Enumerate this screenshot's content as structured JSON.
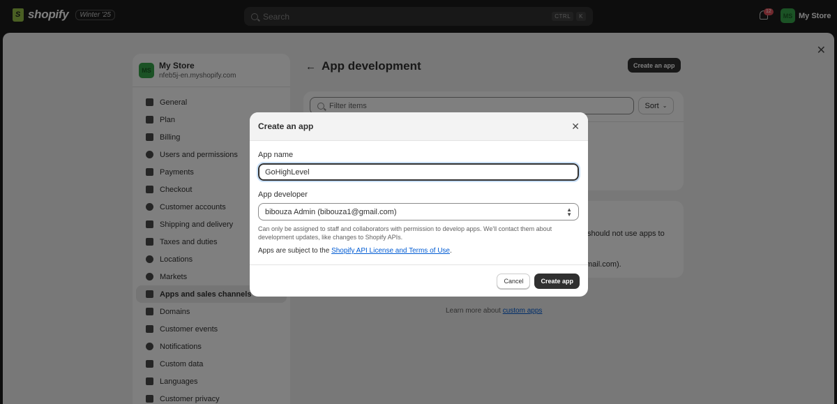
{
  "topbar": {
    "brand": "shopify",
    "edition_badge": "Winter '25",
    "search_placeholder": "Search",
    "shortcut_keys": [
      "CTRL",
      "K"
    ],
    "notification_count": "12",
    "user_initials": "MS",
    "user_name": "My Store"
  },
  "sidebar": {
    "store_initials": "MS",
    "store_name": "My Store",
    "store_domain": "nfeb5j-en.myshopify.com",
    "items": [
      {
        "label": "General",
        "icon": "store-icon"
      },
      {
        "label": "Plan",
        "icon": "plan-icon"
      },
      {
        "label": "Billing",
        "icon": "receipt-icon"
      },
      {
        "label": "Users and permissions",
        "icon": "users-icon"
      },
      {
        "label": "Payments",
        "icon": "payments-icon"
      },
      {
        "label": "Checkout",
        "icon": "cart-icon"
      },
      {
        "label": "Customer accounts",
        "icon": "person-icon"
      },
      {
        "label": "Shipping and delivery",
        "icon": "truck-icon"
      },
      {
        "label": "Taxes and duties",
        "icon": "tax-icon"
      },
      {
        "label": "Locations",
        "icon": "location-icon"
      },
      {
        "label": "Markets",
        "icon": "globe-icon"
      },
      {
        "label": "Apps and sales channels",
        "icon": "apps-icon"
      },
      {
        "label": "Domains",
        "icon": "domain-icon"
      },
      {
        "label": "Customer events",
        "icon": "cursor-icon"
      },
      {
        "label": "Notifications",
        "icon": "bell-icon"
      },
      {
        "label": "Custom data",
        "icon": "data-icon"
      },
      {
        "label": "Languages",
        "icon": "language-icon"
      },
      {
        "label": "Customer privacy",
        "icon": "lock-icon"
      }
    ],
    "active_index": 11
  },
  "main": {
    "title": "App development",
    "create_button": "Create an app",
    "filter_placeholder": "Filter items",
    "sort_label": "Sort",
    "card2_text_1": "should not use apps to",
    "card2_text_2": "mail.com).",
    "learn_prefix": "Learn more about ",
    "learn_link": "custom apps"
  },
  "modal": {
    "title": "Create an app",
    "app_name_label": "App name",
    "app_name_value": "GoHighLevel",
    "app_developer_label": "App developer",
    "app_developer_value": "bibouza Admin (bibouza1@gmail.com)",
    "help_text": "Can only be assigned to staff and collaborators with permission to develop apps. We'll contact them about development updates, like changes to Shopify APIs.",
    "terms_prefix": "Apps are subject to the ",
    "terms_link": "Shopify API License and Terms of Use",
    "terms_suffix": ".",
    "cancel_label": "Cancel",
    "create_label": "Create app"
  }
}
